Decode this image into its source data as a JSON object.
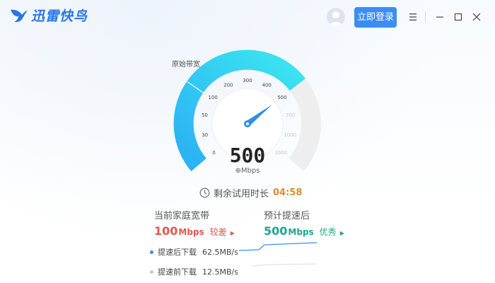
{
  "app": {
    "name": "迅雷快鸟"
  },
  "header": {
    "login_label": "立即登录"
  },
  "gauge": {
    "label": "原始带宽",
    "ticks": [
      "0",
      "30",
      "50",
      "100",
      "200",
      "300",
      "400",
      "500",
      "700",
      "1000",
      "2000"
    ],
    "value": "500",
    "unit": "Mbps",
    "needle_tick": "500"
  },
  "trial": {
    "label": "剩余试用时长",
    "time": "04:58"
  },
  "current": {
    "label": "当前家庭宽带",
    "value": "100",
    "unit": "Mbps",
    "rating": "较差"
  },
  "after": {
    "label": "预计提速后",
    "value": "500",
    "unit": "Mbps",
    "rating": "优秀"
  },
  "legend": [
    {
      "label": "提速后下载",
      "value": "62.5MB/s"
    },
    {
      "label": "提速前下载",
      "value": "12.5MB/s"
    }
  ],
  "colors": {
    "accent": "#3a8df5",
    "bad": "#e2574c",
    "good": "#20a68a",
    "timer": "#e08b2d"
  },
  "icons": {
    "logo": "bird-logo-icon",
    "avatar": "user-avatar-icon",
    "menu": "menu-icon",
    "minimize": "minimize-icon",
    "maximize": "maximize-icon",
    "close": "close-icon",
    "clock": "clock-icon"
  }
}
